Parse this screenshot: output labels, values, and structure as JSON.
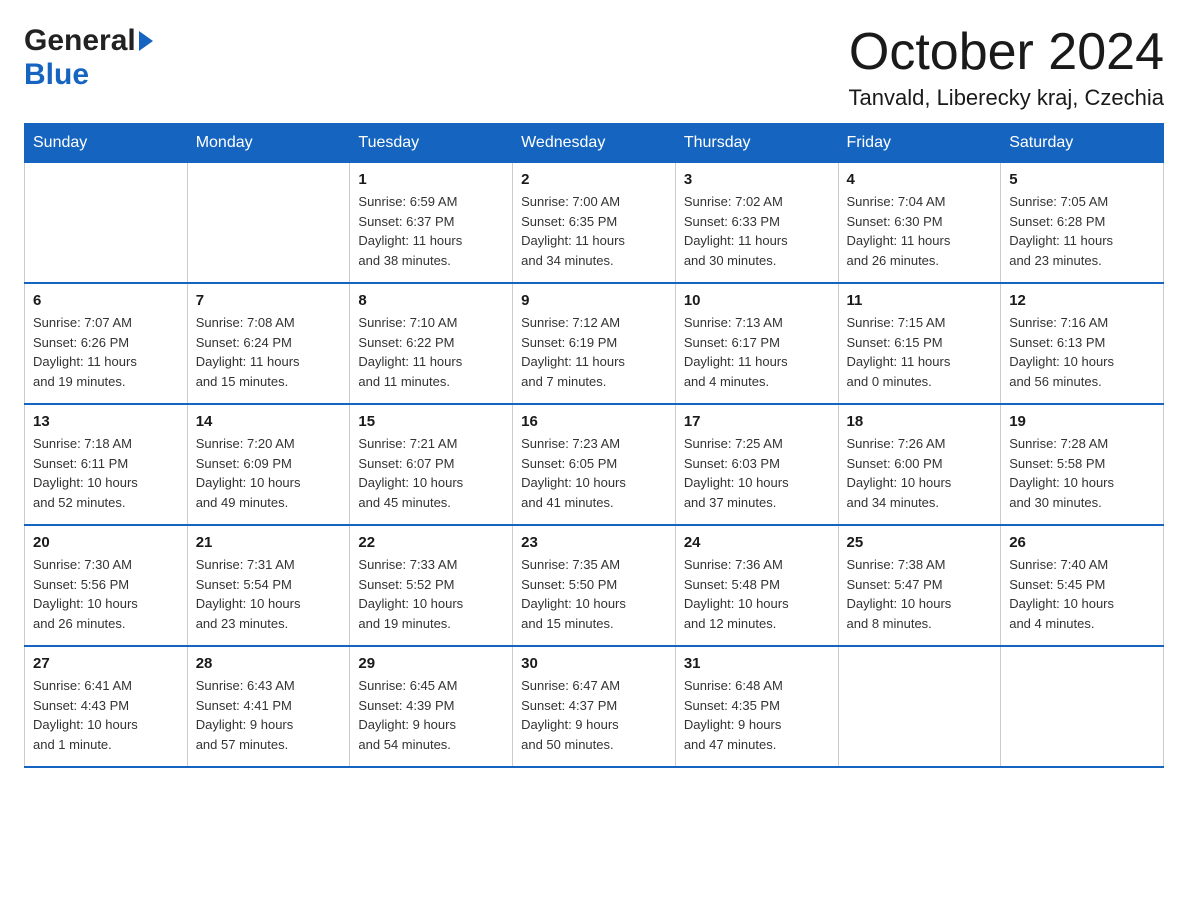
{
  "logo": {
    "general": "General",
    "arrow": "",
    "blue": "Blue"
  },
  "title": {
    "month": "October 2024",
    "location": "Tanvald, Liberecky kraj, Czechia"
  },
  "days_of_week": [
    "Sunday",
    "Monday",
    "Tuesday",
    "Wednesday",
    "Thursday",
    "Friday",
    "Saturday"
  ],
  "weeks": [
    [
      {
        "day": "",
        "info": ""
      },
      {
        "day": "",
        "info": ""
      },
      {
        "day": "1",
        "info": "Sunrise: 6:59 AM\nSunset: 6:37 PM\nDaylight: 11 hours\nand 38 minutes."
      },
      {
        "day": "2",
        "info": "Sunrise: 7:00 AM\nSunset: 6:35 PM\nDaylight: 11 hours\nand 34 minutes."
      },
      {
        "day": "3",
        "info": "Sunrise: 7:02 AM\nSunset: 6:33 PM\nDaylight: 11 hours\nand 30 minutes."
      },
      {
        "day": "4",
        "info": "Sunrise: 7:04 AM\nSunset: 6:30 PM\nDaylight: 11 hours\nand 26 minutes."
      },
      {
        "day": "5",
        "info": "Sunrise: 7:05 AM\nSunset: 6:28 PM\nDaylight: 11 hours\nand 23 minutes."
      }
    ],
    [
      {
        "day": "6",
        "info": "Sunrise: 7:07 AM\nSunset: 6:26 PM\nDaylight: 11 hours\nand 19 minutes."
      },
      {
        "day": "7",
        "info": "Sunrise: 7:08 AM\nSunset: 6:24 PM\nDaylight: 11 hours\nand 15 minutes."
      },
      {
        "day": "8",
        "info": "Sunrise: 7:10 AM\nSunset: 6:22 PM\nDaylight: 11 hours\nand 11 minutes."
      },
      {
        "day": "9",
        "info": "Sunrise: 7:12 AM\nSunset: 6:19 PM\nDaylight: 11 hours\nand 7 minutes."
      },
      {
        "day": "10",
        "info": "Sunrise: 7:13 AM\nSunset: 6:17 PM\nDaylight: 11 hours\nand 4 minutes."
      },
      {
        "day": "11",
        "info": "Sunrise: 7:15 AM\nSunset: 6:15 PM\nDaylight: 11 hours\nand 0 minutes."
      },
      {
        "day": "12",
        "info": "Sunrise: 7:16 AM\nSunset: 6:13 PM\nDaylight: 10 hours\nand 56 minutes."
      }
    ],
    [
      {
        "day": "13",
        "info": "Sunrise: 7:18 AM\nSunset: 6:11 PM\nDaylight: 10 hours\nand 52 minutes."
      },
      {
        "day": "14",
        "info": "Sunrise: 7:20 AM\nSunset: 6:09 PM\nDaylight: 10 hours\nand 49 minutes."
      },
      {
        "day": "15",
        "info": "Sunrise: 7:21 AM\nSunset: 6:07 PM\nDaylight: 10 hours\nand 45 minutes."
      },
      {
        "day": "16",
        "info": "Sunrise: 7:23 AM\nSunset: 6:05 PM\nDaylight: 10 hours\nand 41 minutes."
      },
      {
        "day": "17",
        "info": "Sunrise: 7:25 AM\nSunset: 6:03 PM\nDaylight: 10 hours\nand 37 minutes."
      },
      {
        "day": "18",
        "info": "Sunrise: 7:26 AM\nSunset: 6:00 PM\nDaylight: 10 hours\nand 34 minutes."
      },
      {
        "day": "19",
        "info": "Sunrise: 7:28 AM\nSunset: 5:58 PM\nDaylight: 10 hours\nand 30 minutes."
      }
    ],
    [
      {
        "day": "20",
        "info": "Sunrise: 7:30 AM\nSunset: 5:56 PM\nDaylight: 10 hours\nand 26 minutes."
      },
      {
        "day": "21",
        "info": "Sunrise: 7:31 AM\nSunset: 5:54 PM\nDaylight: 10 hours\nand 23 minutes."
      },
      {
        "day": "22",
        "info": "Sunrise: 7:33 AM\nSunset: 5:52 PM\nDaylight: 10 hours\nand 19 minutes."
      },
      {
        "day": "23",
        "info": "Sunrise: 7:35 AM\nSunset: 5:50 PM\nDaylight: 10 hours\nand 15 minutes."
      },
      {
        "day": "24",
        "info": "Sunrise: 7:36 AM\nSunset: 5:48 PM\nDaylight: 10 hours\nand 12 minutes."
      },
      {
        "day": "25",
        "info": "Sunrise: 7:38 AM\nSunset: 5:47 PM\nDaylight: 10 hours\nand 8 minutes."
      },
      {
        "day": "26",
        "info": "Sunrise: 7:40 AM\nSunset: 5:45 PM\nDaylight: 10 hours\nand 4 minutes."
      }
    ],
    [
      {
        "day": "27",
        "info": "Sunrise: 6:41 AM\nSunset: 4:43 PM\nDaylight: 10 hours\nand 1 minute."
      },
      {
        "day": "28",
        "info": "Sunrise: 6:43 AM\nSunset: 4:41 PM\nDaylight: 9 hours\nand 57 minutes."
      },
      {
        "day": "29",
        "info": "Sunrise: 6:45 AM\nSunset: 4:39 PM\nDaylight: 9 hours\nand 54 minutes."
      },
      {
        "day": "30",
        "info": "Sunrise: 6:47 AM\nSunset: 4:37 PM\nDaylight: 9 hours\nand 50 minutes."
      },
      {
        "day": "31",
        "info": "Sunrise: 6:48 AM\nSunset: 4:35 PM\nDaylight: 9 hours\nand 47 minutes."
      },
      {
        "day": "",
        "info": ""
      },
      {
        "day": "",
        "info": ""
      }
    ]
  ]
}
